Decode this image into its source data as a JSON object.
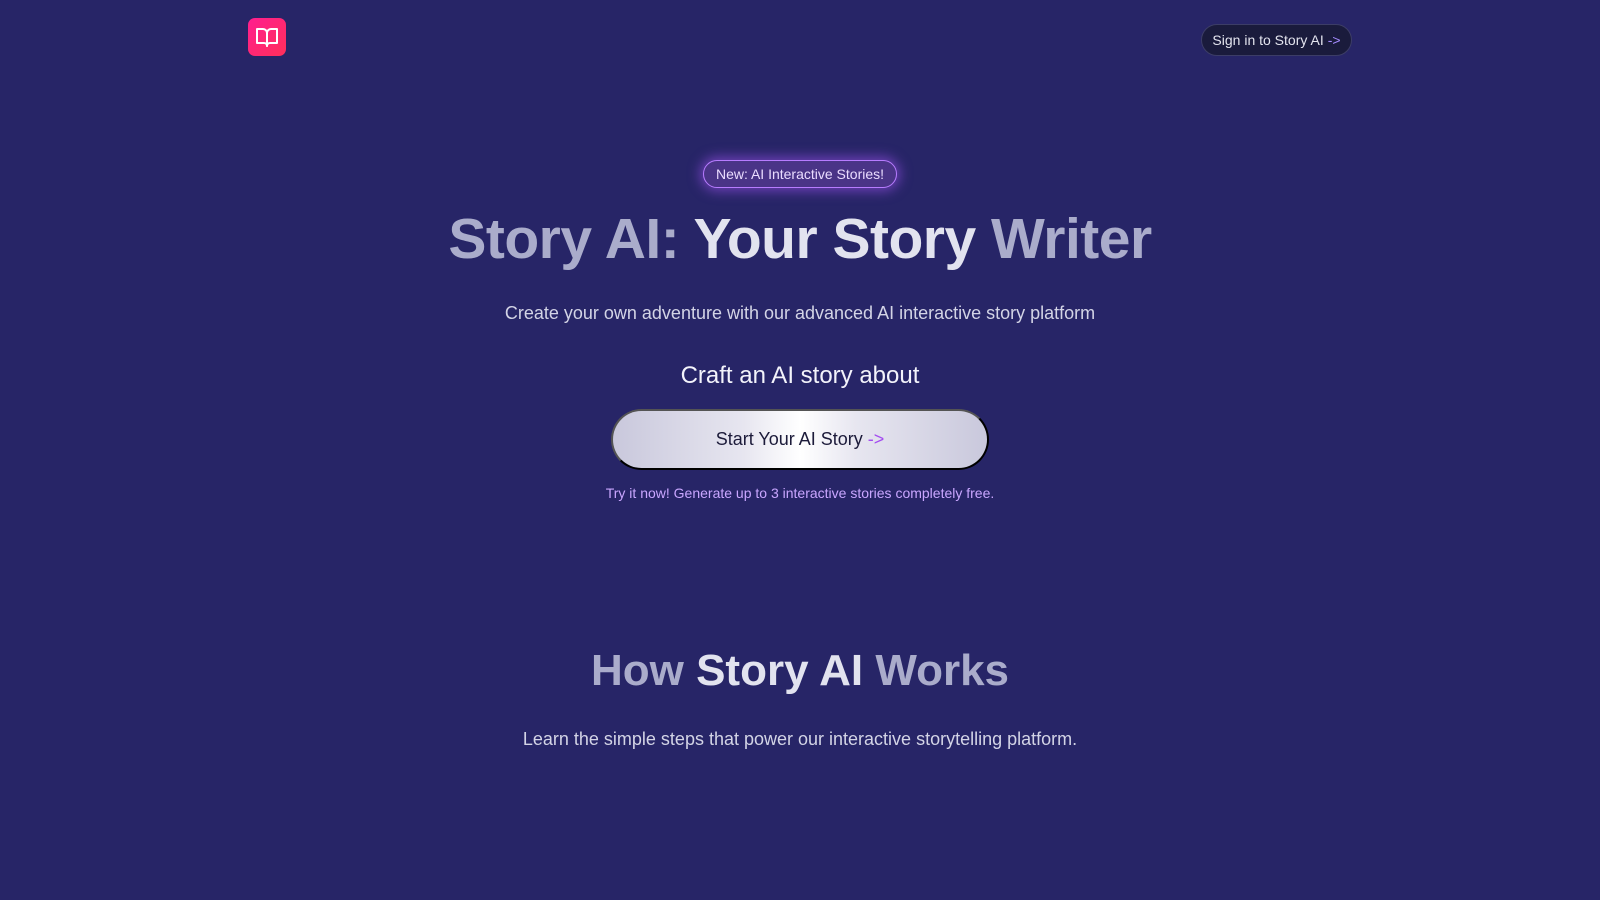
{
  "header": {
    "logo_icon": "open-book-icon",
    "signin_label": "Sign in to Story AI",
    "signin_arrow": "->"
  },
  "hero": {
    "badge": "New: AI Interactive Stories!",
    "title_part1": "Story AI: ",
    "title_part2": "Your Story",
    "title_part3": " Writer",
    "subtitle": "Create your own adventure with our advanced AI interactive story platform",
    "craft_label": "Craft an AI story about",
    "start_button_label": "Start Your AI Story",
    "start_button_arrow": "->",
    "try_note": "Try it now! Generate up to 3 interactive stories completely free."
  },
  "how_it_works": {
    "title_part1": "How ",
    "title_part2": "Story AI",
    "title_part3": " Works",
    "subtitle": "Learn the simple steps that power our interactive storytelling platform."
  },
  "colors": {
    "background": "#272567",
    "logo_gradient_start": "#ff1f8f",
    "logo_gradient_end": "#ff2f5a",
    "accent_purple": "#a855f7",
    "note_color": "#c9a6ff"
  }
}
